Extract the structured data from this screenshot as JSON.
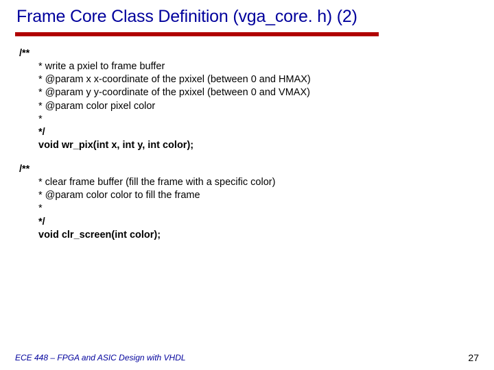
{
  "title": "Frame Core Class Definition (vga_core. h) (2)",
  "block1": {
    "open": "/**",
    "l1": "* write a pxiel to frame buffer",
    "l2": "* @param x x-coordinate of the pxixel (between 0 and HMAX)",
    "l3": "* @param y y-coordinate of the pxixel (between 0 and VMAX)",
    "l4": "* @param color pixel color",
    "l5": "*",
    "close": "*/",
    "decl": "void wr_pix(int x, int y, int color);"
  },
  "block2": {
    "open": "/**",
    "l1": "* clear frame buffer (fill the frame with a specific color)",
    "l2": "* @param color color to fill the frame",
    "l3": "*",
    "close": "*/",
    "decl": "void clr_screen(int color);"
  },
  "footer": {
    "course": "ECE 448 – FPGA and ASIC Design with VHDL",
    "page": "27"
  }
}
